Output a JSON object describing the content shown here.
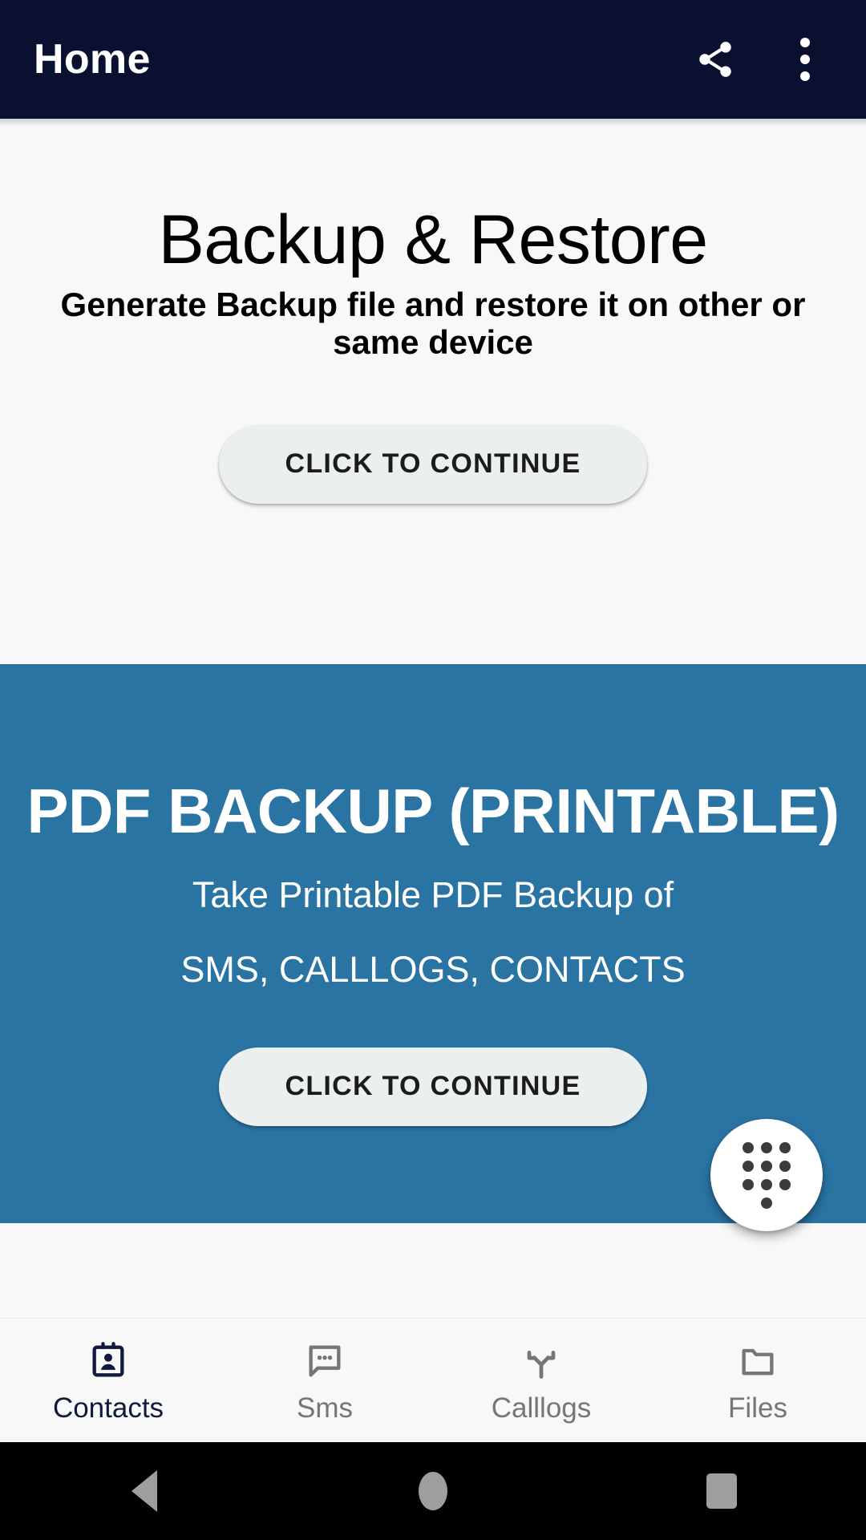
{
  "appbar": {
    "title": "Home",
    "share_icon": "share-icon",
    "overflow_icon": "more-vert-icon"
  },
  "sections": {
    "backup_restore": {
      "title": "Backup & Restore",
      "subtitle": "Generate Backup file and restore it on other or same device",
      "button_label": "CLICK TO CONTINUE"
    },
    "pdf_backup": {
      "title": "PDF BACKUP (PRINTABLE)",
      "line1": "Take Printable PDF Backup of",
      "line2": "SMS, CALLLOGS, CONTACTS",
      "button_label": "CLICK TO CONTINUE",
      "background_color": "#2a74a4"
    }
  },
  "fab": {
    "icon": "dialpad-icon"
  },
  "bottom_nav": {
    "items": [
      {
        "label": "Contacts",
        "icon": "contact-card-icon",
        "active": true
      },
      {
        "label": "Sms",
        "icon": "chat-bubble-icon",
        "active": false
      },
      {
        "label": "Calllogs",
        "icon": "call-split-icon",
        "active": false
      },
      {
        "label": "Files",
        "icon": "folder-icon",
        "active": false
      }
    ],
    "active_color": "#101a3c",
    "inactive_color": "#767676"
  },
  "system_nav": {
    "back": "back-triangle-icon",
    "home": "home-circle-icon",
    "recents": "recents-square-icon"
  }
}
